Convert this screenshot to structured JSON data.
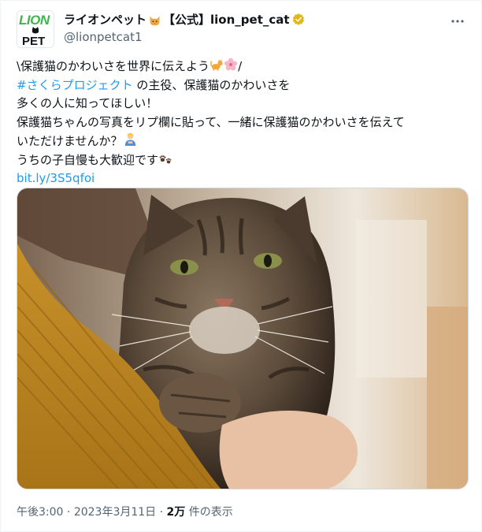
{
  "account": {
    "display_name": "ライオンペット",
    "display_name_suffix": "【公式】lion_pet_cat",
    "handle": "@lionpetcat1",
    "logo_top": "LION",
    "logo_bottom": "PET"
  },
  "tweet": {
    "lines": [
      "\\保護猫のかわいさを世界に伝えよう",
      "の主役、保護猫のかわいさを",
      "多くの人に知ってほしい！",
      "保護猫ちゃんの写真をリプ欄に貼って、一緒に保護猫のかわいさを伝えて",
      "いただけませんか？",
      "うちの子自慢も大歓迎です"
    ],
    "line1_end": "/",
    "hashtag": "#さくらプロジェクト",
    "link": "bit.ly/3S5qfoi"
  },
  "meta": {
    "time": "午後3:00",
    "dot": "·",
    "date": "2023年3月11日",
    "views_count": "2万",
    "views_label": "件の表示"
  },
  "icons": {
    "verified": "verified-badge-icon",
    "more": "more-options-icon",
    "cat_face": "cat-face-emoji",
    "cat": "cat-emoji",
    "flower": "cherry-blossom-emoji",
    "person": "person-emoji",
    "paw": "paw-prints-emoji"
  },
  "colors": {
    "link": "#1d9bf0",
    "logo_green": "#3cb54a",
    "verified_gold": "#e2b719",
    "muted": "#536471"
  }
}
